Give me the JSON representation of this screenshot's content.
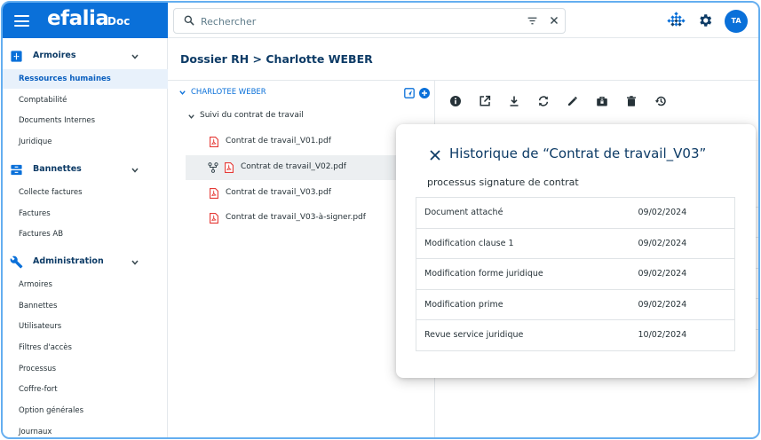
{
  "app": {
    "logo": "efalia",
    "logo_suffix": "Doc"
  },
  "search": {
    "placeholder": "Rechercher",
    "value": ""
  },
  "user": {
    "initials": "TA"
  },
  "sidebar": {
    "sections": [
      {
        "label": "Armoires",
        "icon": "cabinet-icon",
        "items": [
          "Ressources humaines",
          "Comptabilité",
          "Documents Internes",
          "Juridique"
        ],
        "active": "Ressources humaines"
      },
      {
        "label": "Bannettes",
        "icon": "inbox-icon",
        "items": [
          "Collecte factures",
          "Factures",
          "Factures AB"
        ]
      },
      {
        "label": "Administration",
        "icon": "wrench-icon",
        "items": [
          "Armoires",
          "Bannettes",
          "Utilisateurs",
          "Filtres d'accès",
          "Processus",
          "Coffre-fort",
          "Option générales",
          "Journaux"
        ]
      }
    ]
  },
  "breadcrumb": "Dossier RH > Charlotte WEBER",
  "tree": {
    "root": "CHARLOTEE WEBER",
    "folder": "Suivi du contrat de travail",
    "files": [
      "Contrat de travail_V01.pdf",
      "Contrat de travail_V02.pdf",
      "Contrat de travail_V03.pdf",
      "Contrat de travail_V03-à-signer.pdf"
    ],
    "selected_index": 1
  },
  "toolbar": [
    "info-icon",
    "open-external-icon",
    "download-icon",
    "sync-icon",
    "edit-icon",
    "briefcase-lock-icon",
    "delete-icon",
    "history-icon"
  ],
  "modal": {
    "title": "Historique de “Contrat de travail_V03”",
    "subtitle": "processus signature de contrat",
    "rows": [
      {
        "event": "Document attaché",
        "date": "09/02/2024"
      },
      {
        "event": "Modification clause 1",
        "date": "09/02/2024"
      },
      {
        "event": "Modification forme juridique",
        "date": "09/02/2024"
      },
      {
        "event": "Modification prime",
        "date": "09/02/2024"
      },
      {
        "event": "Revue service juridique",
        "date": "10/02/2024"
      }
    ]
  },
  "colors": {
    "brand": "#0a70d9",
    "navy": "#0d3b66",
    "active_bg": "#e8f1fb",
    "pdf_red": "#e53935"
  }
}
